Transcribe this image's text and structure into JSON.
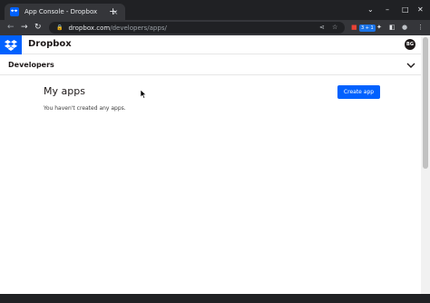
{
  "browser": {
    "tab_title": "App Console - Dropbox",
    "tab_close_glyph": "×",
    "new_tab_glyph": "+",
    "url_host": "dropbox.com",
    "url_path": "/developers/apps/",
    "back_glyph": "←",
    "forward_glyph": "→",
    "reload_glyph": "↻",
    "lock_glyph": "🔒",
    "share_glyph": "⋖",
    "star_glyph": "☆",
    "window_controls": {
      "menu": "⌄",
      "minimize": "–",
      "maximize": "□",
      "close": "✕"
    },
    "ext_badge": "3 + 1",
    "puzzle_glyph": "✦",
    "sidepanel_glyph": "◧",
    "profile_glyph": "●",
    "kebab_glyph": "⋮"
  },
  "header": {
    "brand": "Dropbox",
    "avatar_initials": "BG"
  },
  "devbar": {
    "title": "Developers"
  },
  "main": {
    "heading": "My apps",
    "empty_text": "You haven't created any apps.",
    "create_button": "Create app"
  },
  "colors": {
    "dropbox_blue": "#0061fe",
    "chrome_dark": "#202124",
    "chrome_toolbar": "#35363a"
  },
  "icons": [
    "dropbox-logo-icon",
    "chevron-down-icon",
    "lock-icon",
    "mouse-cursor-icon"
  ]
}
